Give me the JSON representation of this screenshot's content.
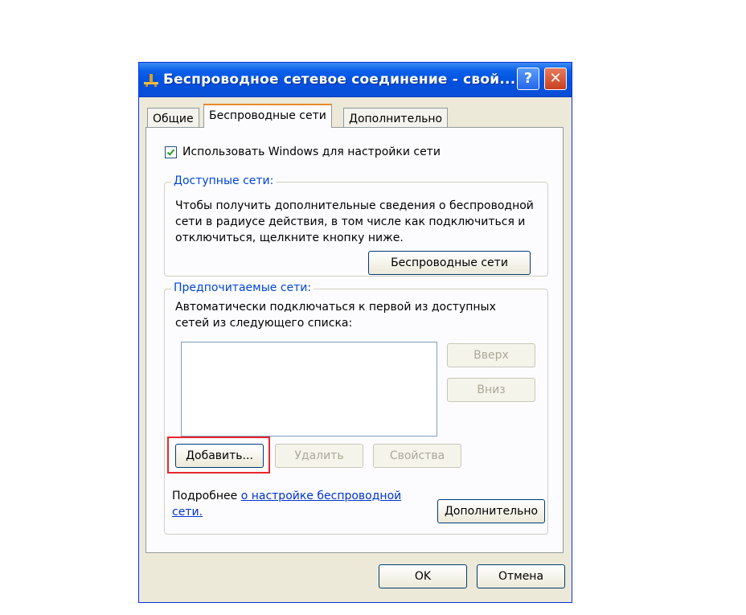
{
  "window": {
    "title": "Беспроводное сетевое соединение - свой...",
    "help_label": "?",
    "close_label": "✕"
  },
  "tabs": [
    {
      "label": "Общие"
    },
    {
      "label": "Беспроводные сети"
    },
    {
      "label": "Дополнительно"
    }
  ],
  "settings": {
    "use_windows_label": "Использовать Windows для настройки сети",
    "use_windows_checked": true
  },
  "available": {
    "legend": "Доступные сети:",
    "line1": "Чтобы получить дополнительные сведения о беспроводной",
    "line2": "сети в радиусе действия, в том числе как подключиться и",
    "line3": "отключиться, щелкните кнопку ниже.",
    "button": "Беспроводные сети"
  },
  "preferred": {
    "legend": "Предпочитаемые сети:",
    "line1": "Автоматически подключаться к первой из доступных",
    "line2": "сетей из следующего списка:",
    "up_button": "Вверх",
    "down_button": "Вниз",
    "add_button": "Добавить...",
    "remove_button": "Удалить",
    "properties_button": "Свойства",
    "more_prefix": "Подробнее ",
    "more_link_part1": "о настройке  беспроводной",
    "more_link_part2": "сети.",
    "advanced_button": "Дополнительно"
  },
  "footer": {
    "ok_button": "OK",
    "cancel_button": "Отмена"
  },
  "colors": {
    "titlebar": "#0050de",
    "highlight": "#e8262a",
    "link": "#0033cc"
  }
}
